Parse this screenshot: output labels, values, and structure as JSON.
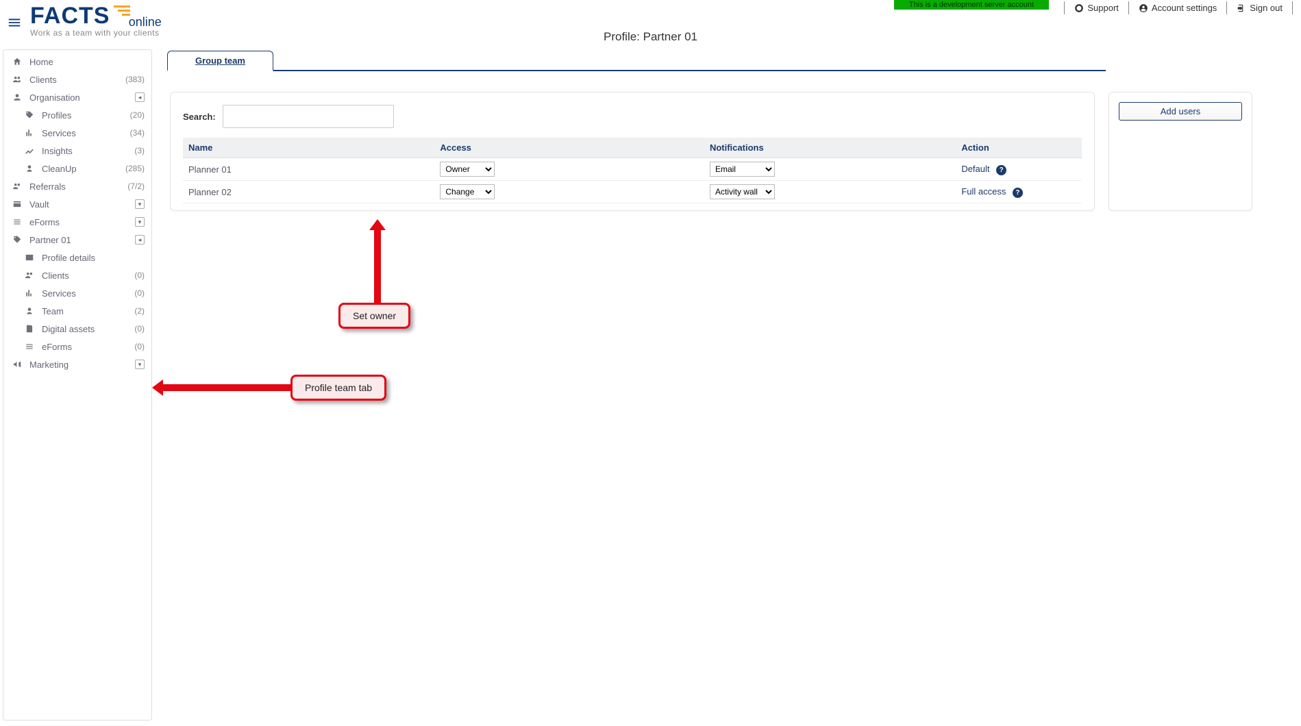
{
  "brand": {
    "facts": "FACTS",
    "online": "online",
    "tagline": "Work as a team with your clients"
  },
  "dev_banner": "This is a development server account",
  "toplinks": {
    "support": "Support",
    "account_settings": "Account settings",
    "sign_out": "Sign out"
  },
  "page_title": "Profile: Partner 01",
  "sidebar": {
    "home": "Home",
    "clients": {
      "label": "Clients",
      "count": "(383)"
    },
    "organisation": {
      "label": "Organisation"
    },
    "profiles": {
      "label": "Profiles",
      "count": "(20)"
    },
    "services": {
      "label": "Services",
      "count": "(34)"
    },
    "insights": {
      "label": "Insights",
      "count": "(3)"
    },
    "cleanup": {
      "label": "CleanUp",
      "count": "(285)"
    },
    "referrals": {
      "label": "Referrals",
      "count": "(7/2)"
    },
    "vault": {
      "label": "Vault"
    },
    "eforms": {
      "label": "eForms"
    },
    "partner01": {
      "label": "Partner 01"
    },
    "profile_details": {
      "label": "Profile details"
    },
    "p_clients": {
      "label": "Clients",
      "count": "(0)"
    },
    "p_services": {
      "label": "Services",
      "count": "(0)"
    },
    "p_team": {
      "label": "Team",
      "count": "(2)"
    },
    "p_digital": {
      "label": "Digital assets",
      "count": "(0)"
    },
    "p_eforms": {
      "label": "eForms",
      "count": "(0)"
    },
    "marketing": {
      "label": "Marketing"
    }
  },
  "tabs": {
    "group_team": "Group team"
  },
  "search": {
    "label": "Search:",
    "value": ""
  },
  "table": {
    "headers": {
      "name": "Name",
      "access": "Access",
      "notifications": "Notifications",
      "action": "Action"
    },
    "rows": [
      {
        "name": "Planner 01",
        "access": "Owner",
        "notifications": "Email",
        "action": "Default"
      },
      {
        "name": "Planner 02",
        "access": "Change",
        "notifications": "Activity wall",
        "action": "Full access"
      }
    ]
  },
  "buttons": {
    "add_users": "Add users"
  },
  "annotations": {
    "set_owner": "Set owner",
    "profile_team_tab": "Profile team tab"
  },
  "colors": {
    "brand_navy": "#0e3a74",
    "brand_orange": "#f5a623",
    "annotation_red": "#e30613",
    "dev_green": "#0aab00"
  }
}
